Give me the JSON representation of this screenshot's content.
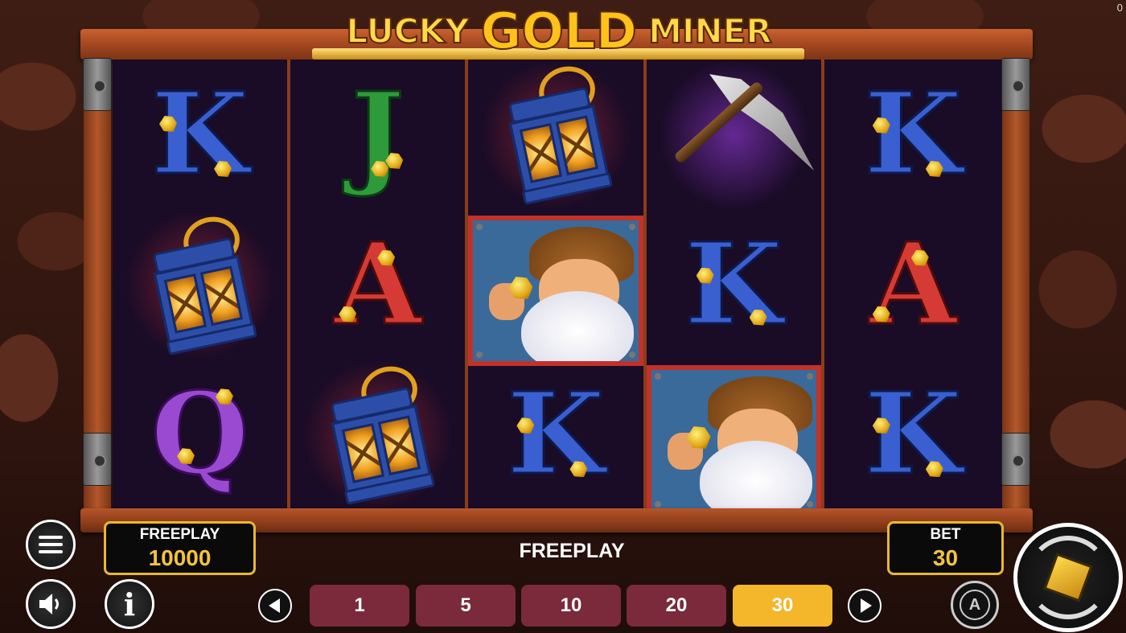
{
  "game": {
    "title_word_1": "LUCKY",
    "title_word_2": "GOLD",
    "title_word_3": "MINER",
    "corner_counter": "0"
  },
  "reels": [
    [
      "K",
      "lantern",
      "Q"
    ],
    [
      "J",
      "A",
      "lantern"
    ],
    [
      "lantern",
      "miner",
      "K"
    ],
    [
      "pickaxe",
      "K",
      "miner"
    ],
    [
      "K",
      "A",
      "K"
    ]
  ],
  "balance": {
    "label": "FREEPLAY",
    "value": "10000"
  },
  "status_text": "FREEPLAY",
  "bet": {
    "label": "BET",
    "value": "30"
  },
  "bet_options": [
    "1",
    "5",
    "10",
    "20",
    "30"
  ],
  "selected_bet": "30",
  "icons": {
    "menu": "hamburger-menu-icon",
    "sound": "speaker-icon",
    "info": "info-icon",
    "prev": "arrow-left-icon",
    "next": "arrow-right-icon",
    "autoplay": "autoplay-icon",
    "spin": "spin-icon"
  },
  "info_glyph": "i",
  "autoplay_glyph": "A",
  "colors": {
    "accent": "#f4b62a",
    "bet_button": "#7a2a3a",
    "panel_border": "#e8b830",
    "value_text": "#f4c243"
  }
}
